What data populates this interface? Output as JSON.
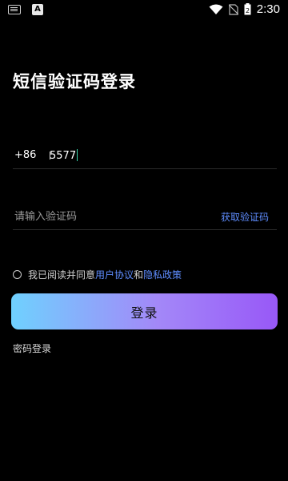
{
  "status_bar": {
    "time": "2:30",
    "battery_level": "2",
    "a_icon": "A"
  },
  "page": {
    "title": "短信验证码登录"
  },
  "phone": {
    "country_code": "+86",
    "value": "5577"
  },
  "code": {
    "placeholder": "请输入验证码",
    "get_code_label": "获取验证码"
  },
  "agreement": {
    "prefix": "我已阅读并同意",
    "user_agreement": "用户协议",
    "and": "和",
    "privacy_policy": "隐私政策"
  },
  "login_button": {
    "label": "登录"
  },
  "password_login": {
    "label": "密码登录"
  },
  "colors": {
    "background": "#000000",
    "link": "#5f8dff",
    "button_gradient_start": "#6fd1fe",
    "button_gradient_end": "#9858f7",
    "caret": "#38d3a9"
  }
}
